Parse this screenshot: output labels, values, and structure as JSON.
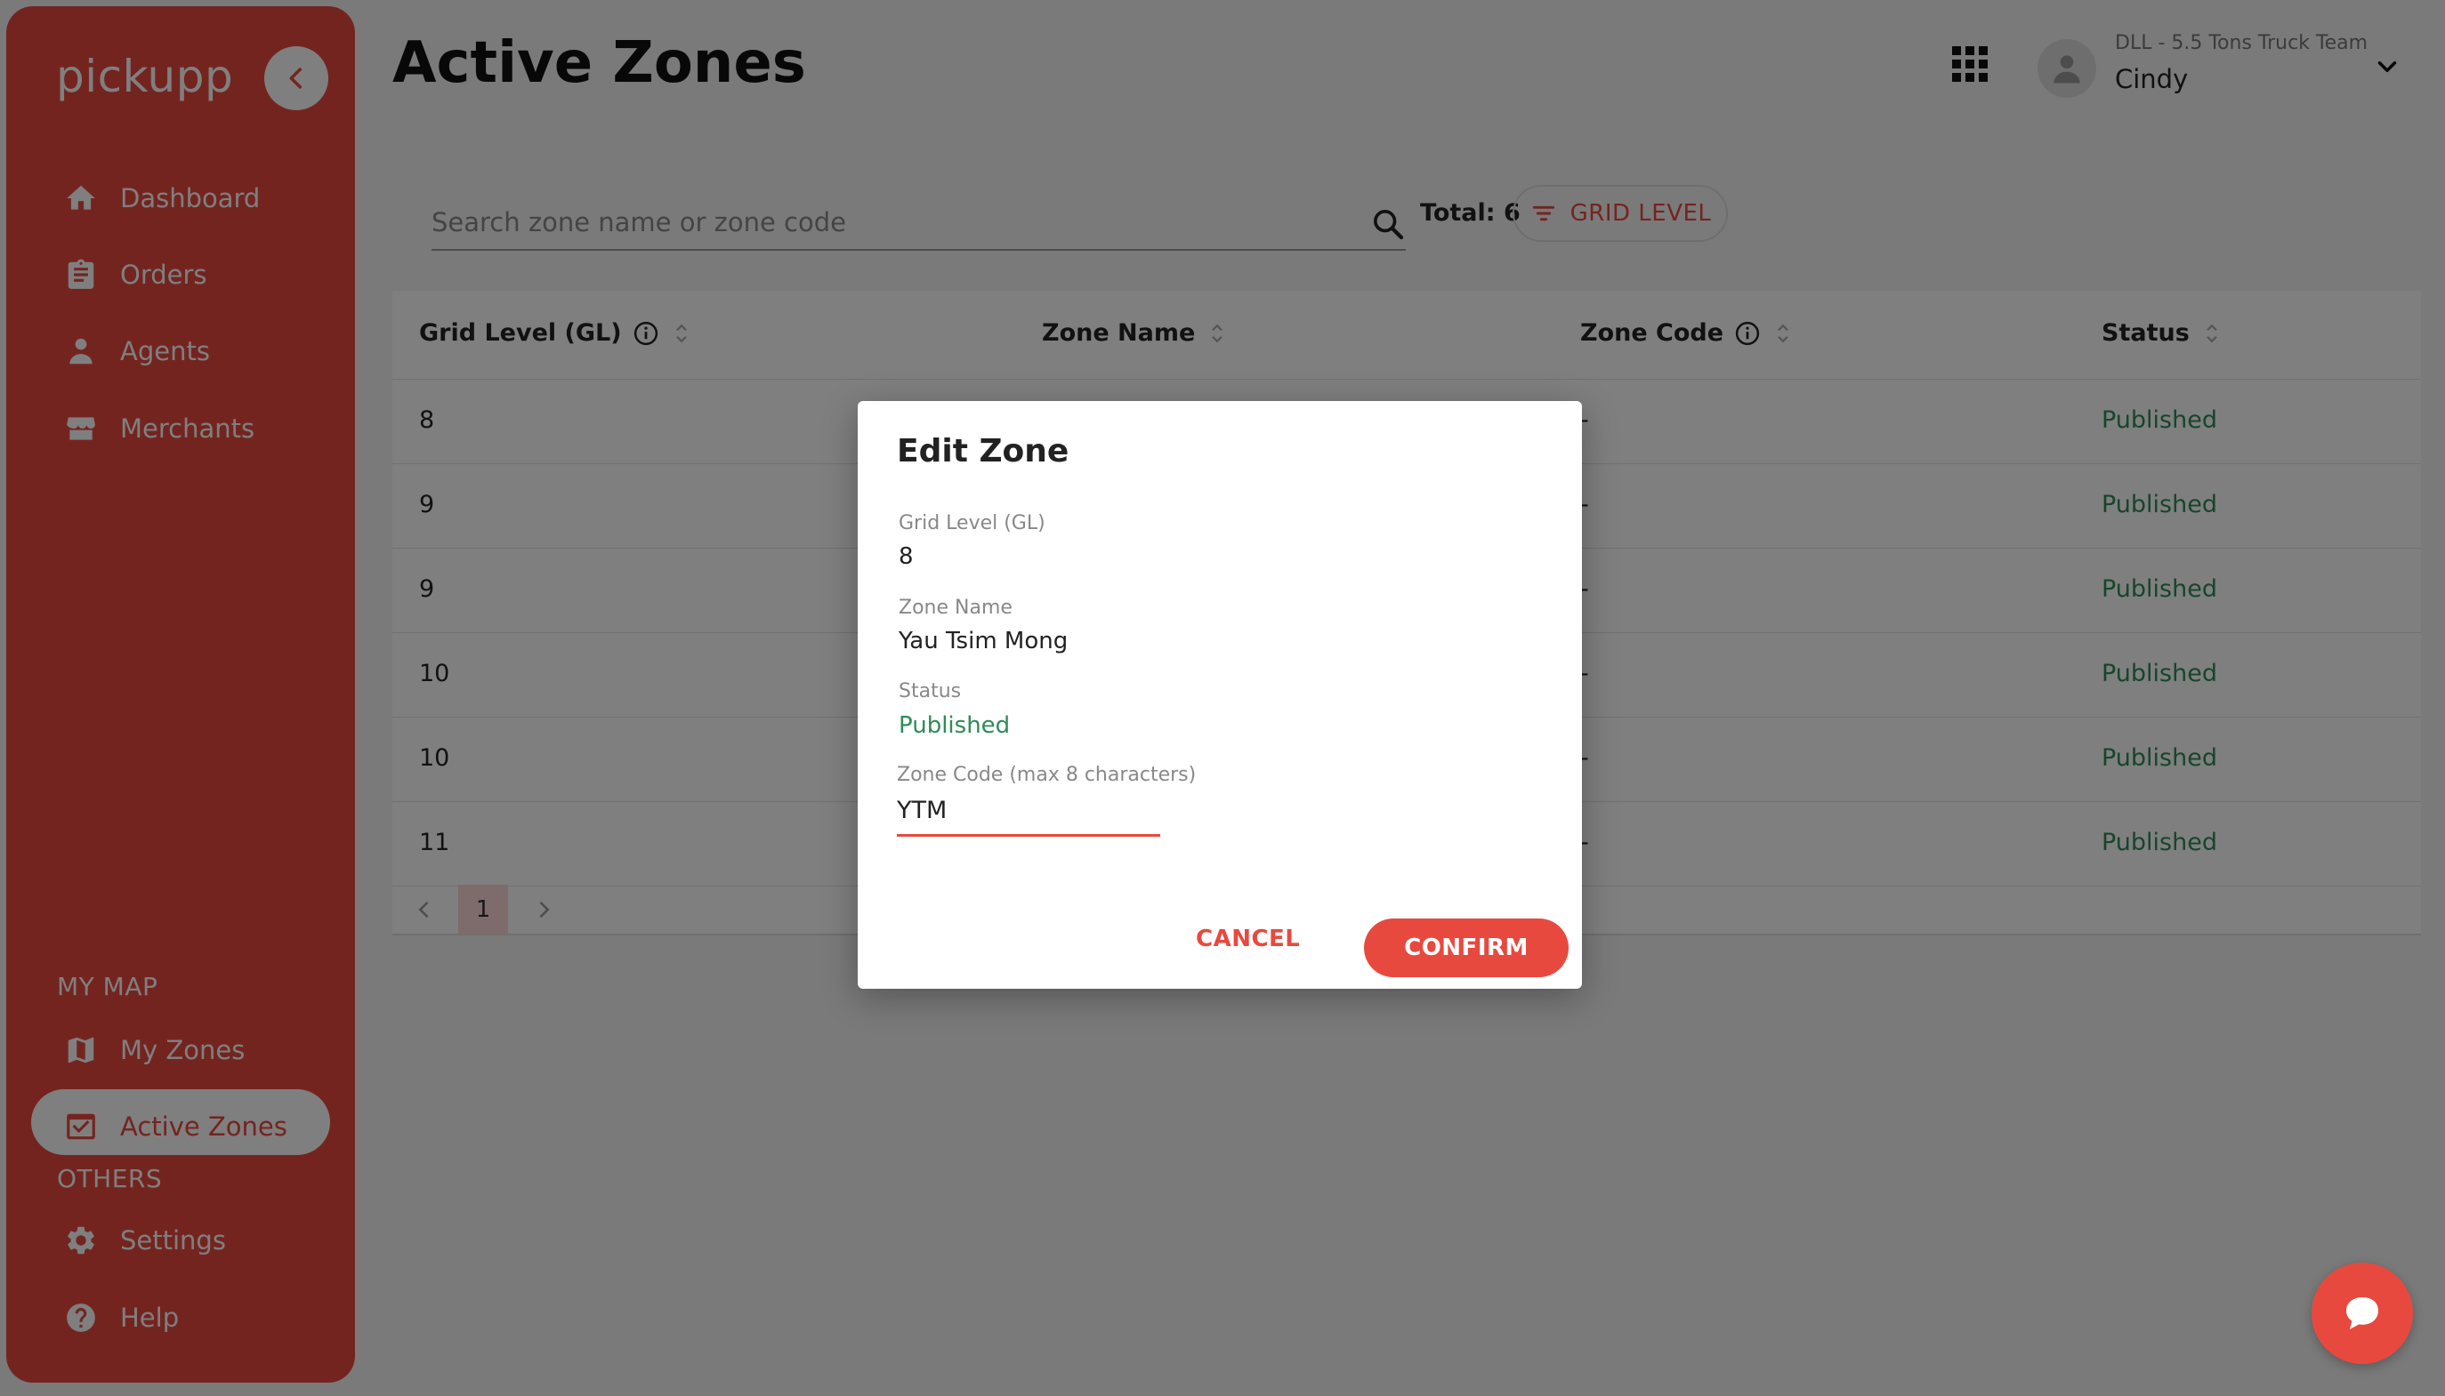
{
  "brand": "pickupp",
  "page_title": "Active Zones",
  "header": {
    "team": "DLL - 5.5 Tons Truck Team",
    "user": "Cindy"
  },
  "sidebar": {
    "items": [
      {
        "label": "Dashboard",
        "icon": "home-icon"
      },
      {
        "label": "Orders",
        "icon": "clipboard-icon"
      },
      {
        "label": "Agents",
        "icon": "agent-icon"
      },
      {
        "label": "Merchants",
        "icon": "store-icon"
      }
    ],
    "section_map": "MY MAP",
    "map_items": [
      {
        "label": "My Zones",
        "icon": "map-icon"
      },
      {
        "label": "Active Zones",
        "icon": "check-calendar-icon",
        "active": true
      }
    ],
    "section_others": "OTHERS",
    "other_items": [
      {
        "label": "Settings",
        "icon": "gear-icon"
      },
      {
        "label": "Help",
        "icon": "help-icon"
      }
    ]
  },
  "toolbar": {
    "search_placeholder": "Search zone name or zone code",
    "total": "Total: 6",
    "grid_level_label": "GRID LEVEL"
  },
  "table": {
    "headers": [
      "Grid Level (GL)",
      "Zone Name",
      "Zone Code",
      "Status"
    ],
    "rows": [
      {
        "gl": "8",
        "code": "-",
        "status": "Published"
      },
      {
        "gl": "9",
        "code": "-",
        "status": "Published"
      },
      {
        "gl": "9",
        "code": "-",
        "status": "Published"
      },
      {
        "gl": "10",
        "code": "-",
        "status": "Published"
      },
      {
        "gl": "10",
        "code": "-",
        "status": "Published"
      },
      {
        "gl": "11",
        "code": "-",
        "status": "Published"
      }
    ],
    "page": "1"
  },
  "modal": {
    "title": "Edit Zone",
    "grid_level_label": "Grid Level (GL)",
    "grid_level_value": "8",
    "zone_name_label": "Zone Name",
    "zone_name_value": "Yau Tsim Mong",
    "status_label": "Status",
    "status_value": "Published",
    "zone_code_label": "Zone Code (max 8 characters)",
    "zone_code_value": "YTM",
    "cancel_label": "CANCEL",
    "confirm_label": "CONFIRM"
  },
  "colors": {
    "brand": "#e8493f",
    "status_green": "#2e8b57"
  }
}
